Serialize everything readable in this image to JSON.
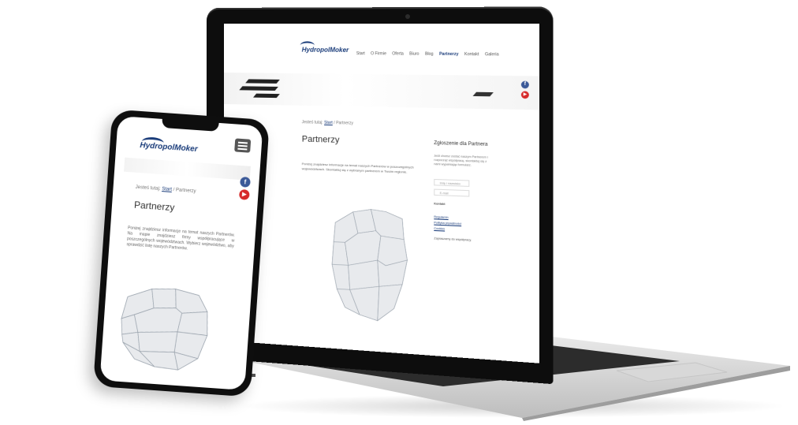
{
  "desktop": {
    "logo_text": "HydropolMoker",
    "nav": [
      "Start",
      "O Firmie",
      "Oferta",
      "Biuro",
      "Blog",
      "Partnerzy",
      "Kontakt",
      "Galeria"
    ],
    "nav_active_index": 5,
    "breadcrumb": {
      "prefix": "Jesteś tutaj:",
      "home": "Start",
      "separator": "/",
      "current": "Partnerzy"
    },
    "title": "Partnerzy",
    "intro": "Poniżej znajdziesz informacje na temat naszych Partnerów w poszczególnych województwach. Skontaktuj się z wybranym partnerem w Twoim regionie.",
    "sidebar": {
      "title": "Zgłoszenie dla Partnera",
      "text": "Jeśli chcesz zostać naszym Partnerem i rozpocząć współpracę, skontaktuj się z nami wypełniając formularz.",
      "field1_placeholder": "Imię i nazwisko",
      "field2_placeholder": "E-mail",
      "section_label": "Kontakt",
      "links": [
        "Regulamin",
        "Polityka prywatności",
        "Cookies"
      ],
      "footer_note": "Zapraszamy do współpracy."
    }
  },
  "mobile": {
    "logo_text": "HydropolMoker",
    "breadcrumb": {
      "prefix": "Jesteś tutaj:",
      "home": "Start",
      "separator": "/",
      "current": "Partnerzy"
    },
    "title": "Partnerzy",
    "text": "Poniżej znajdziesz informacje na temat naszych Partnerów. Na mapie znajdziesz firmy współpracujące w poszczególnych województwach. Wybierz województwo, aby sprawdzić listę naszych Partnerów."
  },
  "social": {
    "facebook_glyph": "f",
    "youtube_glyph": "▶"
  },
  "colors": {
    "brand": "#1a3c7a",
    "facebook": "#3b5998",
    "youtube": "#d62a2a"
  },
  "icons": [
    "hamburger-menu-icon",
    "facebook-icon",
    "youtube-icon",
    "poland-map"
  ]
}
